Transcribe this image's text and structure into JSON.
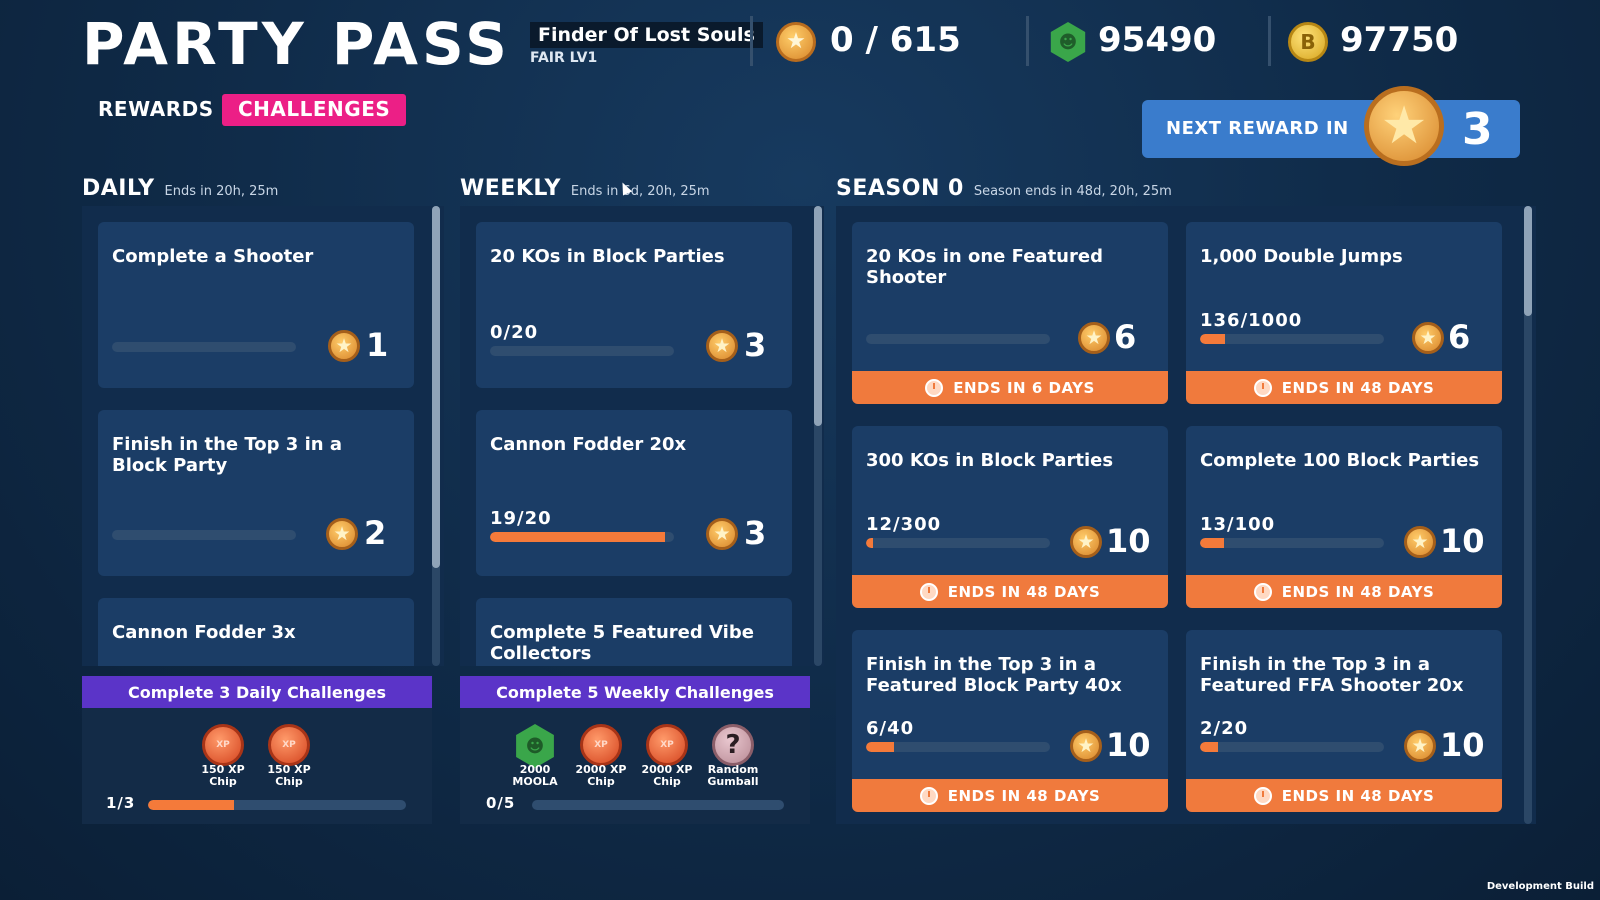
{
  "header": {
    "title": "PARTY PASS",
    "player_name": "Finder Of Lost Souls",
    "player_level": "FAIR LV1",
    "currencies": {
      "stars": {
        "value": "0 / 615",
        "icon": "star-coin-icon"
      },
      "moola": {
        "value": "95490",
        "icon": "moola-hex-icon"
      },
      "coins": {
        "value": "97750",
        "icon": "b-coin-icon"
      }
    }
  },
  "tabs": [
    {
      "label": "REWARDS",
      "active": false
    },
    {
      "label": "CHALLENGES",
      "active": true
    }
  ],
  "next_reward": {
    "label": "NEXT REWARD IN",
    "value": "3"
  },
  "daily": {
    "title": "DAILY",
    "subtitle": "Ends in 20h, 25m",
    "cards": [
      {
        "title": "Complete a Shooter",
        "progress_text": "",
        "progress": 0,
        "reward": "1"
      },
      {
        "title": "Finish in the Top 3 in a Block Party",
        "progress_text": "",
        "progress": 0,
        "reward": "2"
      },
      {
        "title": "Cannon Fodder 3x"
      }
    ],
    "group": {
      "title": "Complete 3 Daily Challenges",
      "rewards": [
        {
          "label": "150 XP Chip",
          "icon": "xp-chip-icon"
        },
        {
          "label": "150 XP Chip",
          "icon": "xp-chip-icon"
        }
      ],
      "progress_text": "1/3",
      "progress": 0.333
    }
  },
  "weekly": {
    "title": "WEEKLY",
    "subtitle": "Ends in 6d, 20h, 25m",
    "cards": [
      {
        "title": "20 KOs in Block Parties",
        "progress_text": "0/20",
        "progress": 0,
        "reward": "3"
      },
      {
        "title": "Cannon Fodder 20x",
        "progress_text": "19/20",
        "progress": 0.95,
        "reward": "3"
      },
      {
        "title": "Complete 5 Featured Vibe Collectors"
      }
    ],
    "group": {
      "title": "Complete 5 Weekly Challenges",
      "rewards": [
        {
          "label": "2000 MOOLA",
          "icon": "moola-hex-icon"
        },
        {
          "label": "2000 XP Chip",
          "icon": "xp-chip-icon"
        },
        {
          "label": "2000 XP Chip",
          "icon": "xp-chip-icon"
        },
        {
          "label": "Random Gumball",
          "icon": "gumball-icon"
        }
      ],
      "progress_text": "0/5",
      "progress": 0
    }
  },
  "season": {
    "title": "SEASON 0",
    "subtitle": "Season ends in 48d, 20h, 25m",
    "cards": [
      {
        "title": "20 KOs in one Featured Shooter",
        "progress_text": "",
        "progress": 0,
        "reward": "6",
        "ends": "ENDS IN 6 DAYS"
      },
      {
        "title": "1,000 Double Jumps",
        "progress_text": "136/1000",
        "progress": 0.136,
        "reward": "6",
        "ends": "ENDS IN 48 DAYS"
      },
      {
        "title": "300 KOs in Block Parties",
        "progress_text": "12/300",
        "progress": 0.04,
        "reward": "10",
        "ends": "ENDS IN 48 DAYS"
      },
      {
        "title": "Complete 100 Block Parties",
        "progress_text": "13/100",
        "progress": 0.13,
        "reward": "10",
        "ends": "ENDS IN 48 DAYS"
      },
      {
        "title": "Finish in the Top 3 in a Featured Block Party 40x",
        "progress_text": "6/40",
        "progress": 0.15,
        "reward": "10",
        "ends": "ENDS IN 48 DAYS"
      },
      {
        "title": "Finish in the Top 3 in a Featured FFA Shooter 20x",
        "progress_text": "2/20",
        "progress": 0.1,
        "reward": "10",
        "ends": "ENDS IN 48 DAYS"
      }
    ]
  },
  "footer": {
    "dev_build": "Development Build"
  },
  "colors": {
    "background": "#0f2a47",
    "card": "#1b3d66",
    "accent_pink": "#ec1f86",
    "progress_orange": "#f47a3a",
    "group_purple": "#5b34c8",
    "next_reward_blue": "#3a7ccc"
  }
}
